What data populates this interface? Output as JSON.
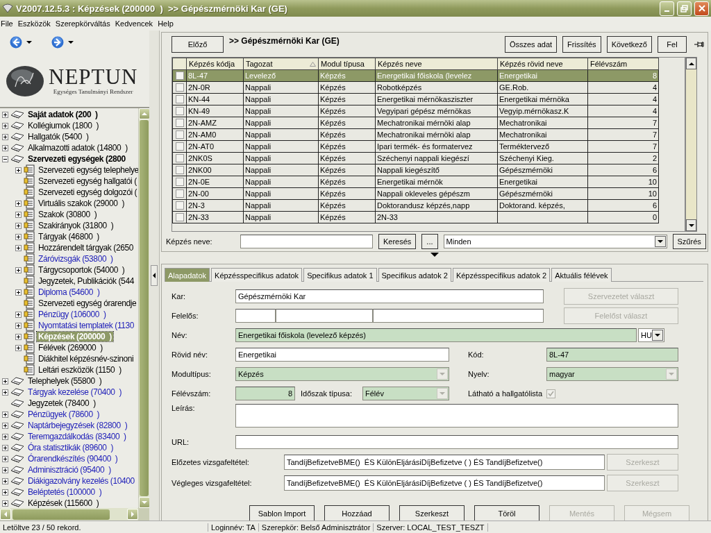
{
  "window": {
    "title": "V2007.12.5.3 : Képzések (200000  )  >> Gépészmérnöki Kar (GE)"
  },
  "menu": [
    "File",
    "Eszközök",
    "Szerepkörváltás",
    "Kedvencek",
    "Help"
  ],
  "logo": {
    "title": "NEPTUN",
    "subtitle": "Egységes Tanulmányi Rendszer"
  },
  "tree": [
    {
      "label": "Saját adatok (200  )",
      "bold": true,
      "color": "#000000",
      "selected": false,
      "expanded": false
    },
    {
      "label": "Kollégiumok (1800  )",
      "bold": false,
      "color": "#000000",
      "selected": false,
      "expanded": false
    },
    {
      "label": "Hallgatók (5400  )",
      "bold": false,
      "color": "#000000",
      "selected": false,
      "expanded": false
    },
    {
      "label": "Alkalmazotti adatok (14800  )",
      "bold": false,
      "color": "#000000",
      "selected": false,
      "expanded": false
    },
    {
      "label": "Szervezeti egységek (2800",
      "bold": true,
      "color": "#000000",
      "selected": false,
      "expanded": true,
      "children": [
        {
          "label": "Szervezeti egység telephelye",
          "bold": false,
          "color": "#000000",
          "selected": false,
          "expanded": false
        },
        {
          "label": "Szervezeti egység hallgatói (",
          "bold": false,
          "color": "#000000",
          "selected": false
        },
        {
          "label": "Szervezeti egység dolgozói (",
          "bold": false,
          "color": "#000000",
          "selected": false
        },
        {
          "label": "Virtuális szakok (29000  )",
          "bold": false,
          "color": "#000000",
          "selected": false,
          "expanded": false
        },
        {
          "label": "Szakok (30800  )",
          "bold": false,
          "color": "#000000",
          "selected": false,
          "expanded": false
        },
        {
          "label": "Szakirányok (31800  )",
          "bold": false,
          "color": "#000000",
          "selected": false,
          "expanded": false
        },
        {
          "label": "Tárgyak (46800  )",
          "bold": false,
          "color": "#000000",
          "selected": false,
          "expanded": false
        },
        {
          "label": "Hozzárendelt tárgyak (2650",
          "bold": false,
          "color": "#000000",
          "selected": false,
          "expanded": false
        },
        {
          "label": "Záróvizsgák (53800  )",
          "bold": false,
          "color": "#1c1cb8",
          "selected": false
        },
        {
          "label": "Tárgycsoportok (54000  )",
          "bold": false,
          "color": "#000000",
          "selected": false,
          "expanded": false
        },
        {
          "label": "Jegyzetek, Publikációk (544",
          "bold": false,
          "color": "#000000",
          "selected": false
        },
        {
          "label": "Diploma (54600  )",
          "bold": false,
          "color": "#1c1cb8",
          "selected": false,
          "expanded": false
        },
        {
          "label": "Szervezeti egység órarendje",
          "bold": false,
          "color": "#000000",
          "selected": false
        },
        {
          "label": "Pénzügy (106000  )",
          "bold": false,
          "color": "#1c1cb8",
          "selected": false,
          "expanded": false
        },
        {
          "label": "Nyomtatási templatek (1130",
          "bold": false,
          "color": "#1c1cb8",
          "selected": false,
          "expanded": false
        },
        {
          "label": "Képzések (200000  )",
          "bold": true,
          "selected": true,
          "expanded": false
        },
        {
          "label": "Félévek (269000  )",
          "bold": false,
          "color": "#000000",
          "selected": false,
          "expanded": false
        },
        {
          "label": "Diákhitel képzésnév-szinoni",
          "bold": false,
          "color": "#000000",
          "selected": false
        },
        {
          "label": "Leltári eszközök (1150  )",
          "bold": false,
          "color": "#000000",
          "selected": false
        }
      ]
    },
    {
      "label": "Telephelyek (55800  )",
      "bold": false,
      "color": "#000000",
      "selected": false,
      "expanded": false
    },
    {
      "label": "Tárgyak kezelése (70400  )",
      "bold": false,
      "color": "#1c1cb8",
      "selected": false,
      "expanded": false
    },
    {
      "label": "Jegyzetek (78400  )",
      "bold": false,
      "color": "#000000",
      "selected": false
    },
    {
      "label": "Pénzügyek (78600  )",
      "bold": false,
      "color": "#1c1cb8",
      "selected": false,
      "expanded": false
    },
    {
      "label": "Naptárbejegyzések (82800  )",
      "bold": false,
      "color": "#1c1cb8",
      "selected": false,
      "expanded": false
    },
    {
      "label": "Teremgazdálkodás (83400  )",
      "bold": false,
      "color": "#1c1cb8",
      "selected": false,
      "expanded": false
    },
    {
      "label": "Óra statisztikák (89600  )",
      "bold": false,
      "color": "#1c1cb8",
      "selected": false,
      "expanded": false
    },
    {
      "label": "Órarendkészítés (90400  )",
      "bold": false,
      "color": "#1c1cb8",
      "selected": false,
      "expanded": false
    },
    {
      "label": "Adminisztráció (95400  )",
      "bold": false,
      "color": "#1c1cb8",
      "selected": false,
      "expanded": false
    },
    {
      "label": "Diákigazolvány kezelés (10400",
      "bold": false,
      "color": "#1c1cb8",
      "selected": false,
      "expanded": false
    },
    {
      "label": "Beléptetés (100000  )",
      "bold": false,
      "color": "#1c1cb8",
      "selected": false,
      "expanded": false
    },
    {
      "label": "Képzések (115600  )",
      "bold": false,
      "color": "#000000",
      "selected": false,
      "expanded": false
    }
  ],
  "list_panel": {
    "prev_button": "Előző",
    "heading": ">> Gépészmérnöki Kar (GE)",
    "buttons": [
      "Összes adat",
      "Frissítés",
      "Következő",
      "Fel"
    ],
    "table": {
      "columns": [
        {
          "label": "Képzés kódja",
          "sorted": false
        },
        {
          "label": "Tagozat",
          "sorted": true
        },
        {
          "label": "Modul típusa",
          "sorted": false
        },
        {
          "label": "Képzés neve",
          "sorted": false
        },
        {
          "label": "Képzés rövid neve",
          "sorted": false
        },
        {
          "label": "Félévszám",
          "sorted": false
        }
      ],
      "rows": [
        {
          "checked": false,
          "selected": true,
          "cells": [
            "8L-47",
            "Levelező",
            "Képzés",
            "Energetikai főiskola (levelez",
            "Energetikai",
            "8"
          ]
        },
        {
          "checked": false,
          "selected": false,
          "cells": [
            "2N-0R",
            "Nappali",
            "Képzés",
            "Robotképzés",
            "GE.Rob.",
            "4"
          ]
        },
        {
          "checked": false,
          "selected": false,
          "cells": [
            "KN-44",
            "Nappali",
            "Képzés",
            "Energetikai mérnökasziszter",
            "Energetikai mérnöka",
            "4"
          ]
        },
        {
          "checked": false,
          "selected": false,
          "cells": [
            "KN-49",
            "Nappali",
            "Képzés",
            "Vegyipari gépész mérnökas",
            "Vegyip.mérnökasz.K",
            "4"
          ]
        },
        {
          "checked": false,
          "selected": false,
          "cells": [
            "2N-AMZ",
            "Nappali",
            "Képzés",
            "Mechatronikai mérnöki alap",
            "Mechatronikai",
            "7"
          ]
        },
        {
          "checked": false,
          "selected": false,
          "cells": [
            "2N-AM0",
            "Nappali",
            "Képzés",
            "Mechatronikai mérnöki alap",
            "Mechatronikai",
            "7"
          ]
        },
        {
          "checked": false,
          "selected": false,
          "cells": [
            "2N-AT0",
            "Nappali",
            "Képzés",
            "Ipari termék- és formatervez",
            "Terméktervező",
            "7"
          ]
        },
        {
          "checked": false,
          "selected": false,
          "cells": [
            "2NK0S",
            "Nappali",
            "Képzés",
            "Széchenyi nappali kiegészí",
            "Széchenyi Kieg.",
            "2"
          ]
        },
        {
          "checked": false,
          "selected": false,
          "cells": [
            "2NK00",
            "Nappali",
            "Képzés",
            "Nappali kiegészítő",
            "Gépészmérnöki",
            "6"
          ]
        },
        {
          "checked": false,
          "selected": false,
          "cells": [
            "2N-0E",
            "Nappali",
            "Képzés",
            "Energetikai mérnök",
            "Energetikai",
            "10"
          ]
        },
        {
          "checked": false,
          "selected": false,
          "cells": [
            "2N-00",
            "Nappali",
            "Képzés",
            "Nappali okleveles gépészm",
            "Gépészmérnöki",
            "10"
          ]
        },
        {
          "checked": false,
          "selected": false,
          "cells": [
            "2N-3",
            "Nappali",
            "Képzés",
            "Doktorandusz képzés,napp",
            "Doktorand. képzés,",
            "6"
          ]
        },
        {
          "checked": false,
          "selected": false,
          "cells": [
            "2N-33",
            "Nappali",
            "Képzés",
            "2N-33",
            null,
            "0"
          ]
        }
      ]
    },
    "search": {
      "label": "Képzés neve:",
      "button": "Keresés",
      "more_button": "...",
      "filter": "Minden",
      "filter_button": "Szűrés"
    }
  },
  "tabs": [
    {
      "label": "Alapadatok",
      "selected": true
    },
    {
      "label": "Képzésspecifikus adatok",
      "selected": false
    },
    {
      "label": "Specifikus adatok 1",
      "selected": false
    },
    {
      "label": "Specifikus adatok 2",
      "selected": false
    },
    {
      "label": "Képzésspecifikus adatok 2",
      "selected": false
    },
    {
      "label": "Aktuális félévek",
      "selected": false
    }
  ],
  "form": {
    "kar": {
      "label": "Kar:",
      "value": "Gépészmérnöki Kar",
      "button": "Szervezetet választ",
      "button_disabled": true
    },
    "felelos": {
      "label": "Felelős:",
      "button": "Felelőst választ",
      "button_disabled": true
    },
    "nev": {
      "label": "Név:",
      "value": "Energetikai főiskola (levelező képzés)",
      "required": true,
      "language": "HU"
    },
    "rovid_nev": {
      "label": "Rövid név:",
      "value": "Energetikai",
      "required": false
    },
    "kod": {
      "label": "Kód:",
      "value": "8L-47",
      "required": true
    },
    "modultipus": {
      "label": "Modultípus:",
      "value": "Képzés",
      "required": true,
      "disabled": true
    },
    "nyelv": {
      "label": "Nyelv:",
      "value": "magyar",
      "required": true,
      "disabled": true
    },
    "felevszam": {
      "label": "Félévszám:",
      "value": "8",
      "required": true
    },
    "idoszak": {
      "label": "Időszak típusa:",
      "value": "Félév",
      "required": true,
      "disabled": true
    },
    "lathato": {
      "label": "Látható a hallgatólista",
      "checked": true,
      "disabled": true
    },
    "leiras": {
      "label": "Leírás:"
    },
    "url": {
      "label": "URL:"
    },
    "elozetes": {
      "label": "Előzetes vizsgafeltétel:",
      "value": "TandíjBefizetveBME()  ÉS KülönEljárásiDíjBefizetve ( ) ÉS TandíjBefizetve()",
      "button": "Szerkeszt",
      "button_disabled": true
    },
    "vegleges": {
      "label": "Végleges vizsgafeltétel:",
      "value": "TandíjBefizetveBME()  ÉS KülönEljárásiDíjBefizetve ( ) ÉS TandíjBefizetve()",
      "button": "Szerkeszt",
      "button_disabled": true
    }
  },
  "actions": [
    {
      "label": "Sablon Import",
      "disabled": false
    },
    {
      "label": "Hozzáad",
      "disabled": false
    },
    {
      "label": "Szerkeszt",
      "disabled": false
    },
    {
      "label": "Töröl",
      "disabled": false
    },
    {
      "label": "Mentés",
      "disabled": true
    },
    {
      "label": "Mégsem",
      "disabled": true
    }
  ],
  "status_bar": {
    "records": "Letöltve 23 / 50 rekord.",
    "login": "Loginnév: TA",
    "role": "Szerepkör: Belső Adminisztrátor",
    "server": "Szerver: LOCAL_TEST_TESZT"
  }
}
